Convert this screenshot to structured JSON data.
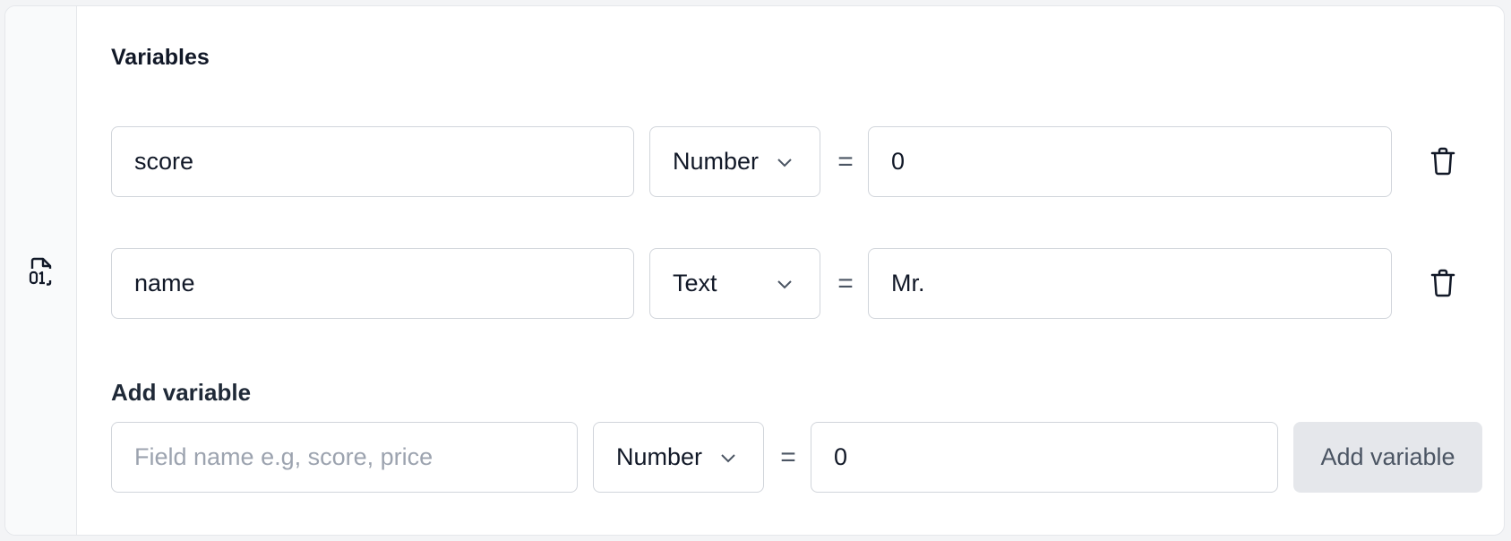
{
  "panel": {
    "title": "Variables",
    "gutter_icon": "binary-file-icon"
  },
  "variables": [
    {
      "name": "score",
      "type": "Number",
      "equals": "=",
      "value": "0"
    },
    {
      "name": "name",
      "type": "Text",
      "equals": "=",
      "value": "Mr."
    }
  ],
  "add": {
    "label": "Add variable",
    "name_placeholder": "Field name e.g, score, price",
    "type": "Number",
    "equals": "=",
    "value": "0",
    "button_label": "Add variable"
  },
  "colors": {
    "border": "#d1d5db",
    "button_bg": "#e5e7eb",
    "gutter_bg": "#f9fafb"
  }
}
